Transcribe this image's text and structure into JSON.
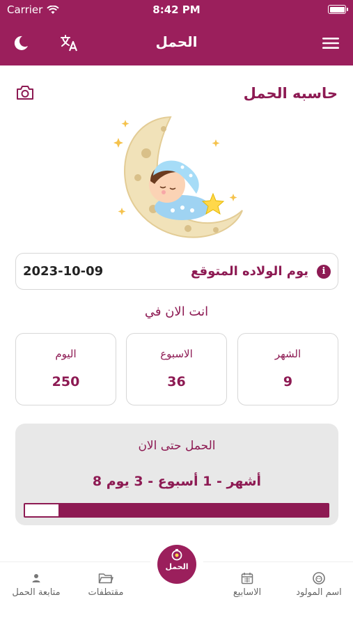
{
  "status_bar": {
    "carrier": "Carrier",
    "time": "8:42 PM"
  },
  "header": {
    "title": "الحمل",
    "icons": [
      "moon-icon",
      "translate-icon",
      "menu-icon"
    ]
  },
  "calculator": {
    "title": "حاسبه الحمل",
    "due_date_label": "يوم الولاده المتوقع",
    "due_date_value": "2023-10-09",
    "now_label": "انت الان في",
    "stats": [
      {
        "label": "الشهر",
        "value": "9"
      },
      {
        "label": "الاسبوع",
        "value": "36"
      },
      {
        "label": "اليوم",
        "value": "250"
      }
    ]
  },
  "progress": {
    "title": "الحمل حتى الان",
    "value_text": "8 أشهر - 1 أسبوع - 3 يوم",
    "remaining_fraction": 0.11
  },
  "tabbar": {
    "tabs": [
      {
        "label": "اسم المولود",
        "icon": "baby-icon"
      },
      {
        "label": "الاسابيع",
        "icon": "calendar-icon"
      },
      {
        "label": "الحمل",
        "icon": "pregnancy-icon"
      },
      {
        "label": "مقتطفات",
        "icon": "folder-icon"
      },
      {
        "label": "متابعة الحمل",
        "icon": "user-icon"
      }
    ]
  },
  "colors": {
    "primary": "#9b1f5c",
    "accent_text": "#8d1a53",
    "card_gray": "#e8e8e8"
  }
}
